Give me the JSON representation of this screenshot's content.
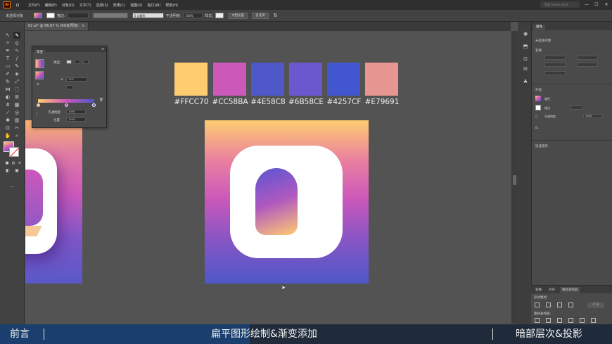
{
  "menubar": {
    "logo": "Ai",
    "items": [
      "文件(F)",
      "编辑(E)",
      "对象(O)",
      "文字(T)",
      "选择(S)",
      "效果(C)",
      "视图(V)",
      "窗口(W)",
      "帮助(H)"
    ],
    "search_placeholder": "搜索 Adobe Stock"
  },
  "controlbar": {
    "selection_label": "未选择对象",
    "stroke_label": "描边:",
    "point_label": "5 点圆形",
    "opacity_label": "不透明度:",
    "opacity_value": "100%",
    "style_label": "样式:",
    "doc_setup": "文档设置",
    "preferences": "首选项"
  },
  "document": {
    "tab_label": "02.ai* @ 66.67 % (RGB/预览)",
    "close_glyph": "×"
  },
  "palette": [
    {
      "hex": "#FFCC70",
      "label": "#FFCC70"
    },
    {
      "hex": "#CC58BA",
      "label": "#CC58BA"
    },
    {
      "hex": "#4E58C8",
      "label": "#4E58C8"
    },
    {
      "hex": "#6B58CE",
      "label": "#6B58CE"
    },
    {
      "hex": "#4257CF",
      "label": "#4257CF"
    },
    {
      "hex": "#E79691",
      "label": "#E79691"
    }
  ],
  "gradient_panel": {
    "title": "渐变",
    "type_label": "类型:",
    "angle_value": "120°",
    "opacity_label": "不透明度",
    "opacity_value": "100%",
    "position_label": "位置",
    "position_value": "100%"
  },
  "properties_panel": {
    "tab": "属性",
    "no_selection": "未选择对象",
    "transform": "变换",
    "appearance": "外观",
    "fill_label": "填色",
    "stroke_label": "描边",
    "opacity_label": "不透明度",
    "opacity_value": "100%",
    "fx": "fx.",
    "quick_actions": "快速操作"
  },
  "pathfinder_panel": {
    "tabs": [
      "变换",
      "对齐",
      "路径查找器"
    ],
    "shape_modes": "形状模式:",
    "expand_button": "扩展",
    "pathfinders": "路径查找器:"
  },
  "bottom_bar": {
    "left": "前言",
    "center": "扁平图形绘制&渐变添加",
    "right": "暗部层次&投影"
  },
  "colors": {
    "gradient_top": "#FFCC70",
    "gradient_mid": "#CC58BA",
    "gradient_bottom": "#4E58C8"
  }
}
